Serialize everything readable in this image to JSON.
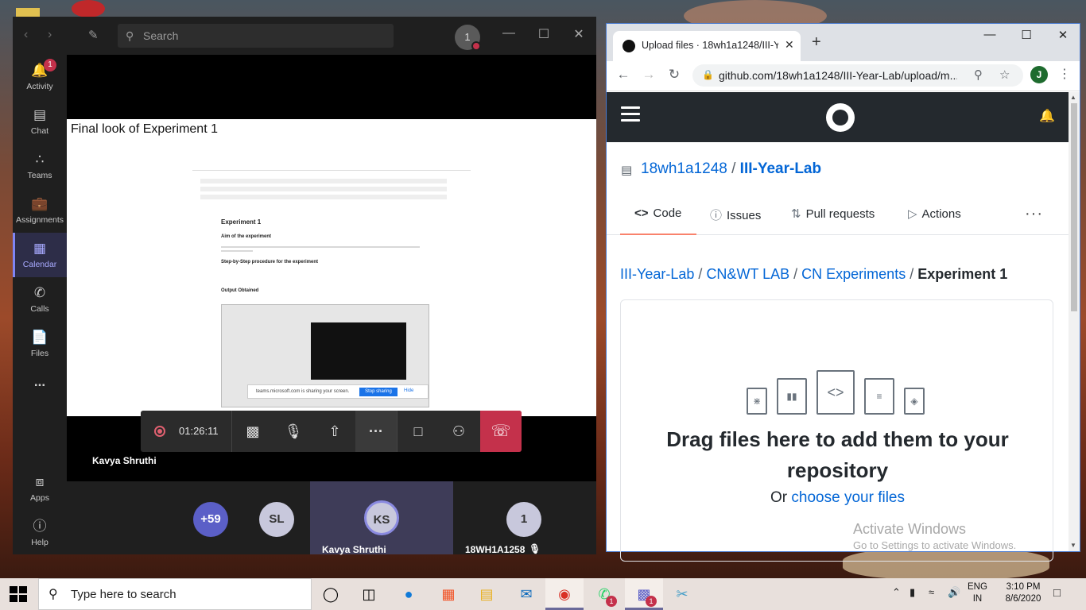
{
  "teams": {
    "search_placeholder": "Search",
    "profile_initial": "1",
    "rail": [
      {
        "label": "Activity",
        "icon": "bell-icon",
        "badge": "1"
      },
      {
        "label": "Chat",
        "icon": "chat-icon"
      },
      {
        "label": "Teams",
        "icon": "teams-icon"
      },
      {
        "label": "Assignments",
        "icon": "assignments-icon"
      },
      {
        "label": "Calendar",
        "icon": "calendar-icon"
      },
      {
        "label": "Calls",
        "icon": "phone-icon"
      },
      {
        "label": "Files",
        "icon": "files-icon"
      },
      {
        "label": "...",
        "icon": "more-icon"
      }
    ],
    "rail_bottom": [
      {
        "label": "Apps",
        "icon": "apps-icon"
      },
      {
        "label": "Help",
        "icon": "help-icon"
      }
    ],
    "shared_title": "Final look of Experiment 1",
    "doc": {
      "heading": "Experiment 1",
      "aim": "Aim of the experiment",
      "procedure": "Step-by-Step procedure for the experiment",
      "output": "Output Obtained",
      "share_text": "teams.microsoft.com is sharing your screen.",
      "stop_sharing": "Stop sharing",
      "hide": "Hide"
    },
    "call_timer": "01:26:11",
    "presenter_name": "Kavya Shruthi",
    "gallery": {
      "overflow": "+59",
      "p1_initials": "SL",
      "p2_initials": "KS",
      "p2_name": "Kavya Shruthi",
      "p3_initials": "1",
      "p3_name": "18WH1A1258"
    },
    "accent": "#7f85f5",
    "hangup_color": "#c4314b"
  },
  "chrome": {
    "tab_title": "Upload files · 18wh1a1248/III-Year-Lab",
    "url": "github.com/18wh1a1248/III-Year-Lab/upload/m...",
    "profile_initial": "J"
  },
  "github": {
    "owner": "18wh1a1248",
    "repo": "III-Year-Lab",
    "tabs": [
      {
        "label": "Code",
        "icon": "code-icon"
      },
      {
        "label": "Issues",
        "icon": "issues-icon"
      },
      {
        "label": "Pull requests",
        "icon": "pull-request-icon"
      },
      {
        "label": "Actions",
        "icon": "actions-icon"
      }
    ],
    "breadcrumb": [
      "III-Year-Lab",
      "CN&WT LAB",
      "CN Experiments",
      "Experiment 1"
    ],
    "drop_title": "Drag files here to add them to your repository",
    "drop_or": "Or",
    "drop_link": "choose your files",
    "link_color": "#0366d6"
  },
  "watermark": {
    "line1": "Activate Windows",
    "line2": "Go to Settings to activate Windows."
  },
  "taskbar": {
    "search_placeholder": "Type here to search",
    "lang_1": "ENG",
    "lang_2": "IN",
    "time": "3:10 PM",
    "date": "8/6/2020",
    "whatsapp_badge": "1",
    "teams_badge": "1"
  }
}
